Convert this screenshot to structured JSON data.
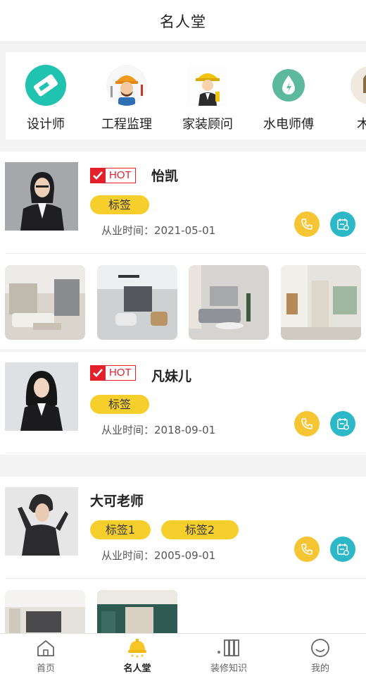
{
  "header": {
    "title": "名人堂"
  },
  "categories": [
    {
      "label": "设计师",
      "icon": "designer-icon"
    },
    {
      "label": "工程监理",
      "icon": "supervisor-icon"
    },
    {
      "label": "家装顾问",
      "icon": "consultant-icon"
    },
    {
      "label": "水电师傅",
      "icon": "plumber-icon"
    },
    {
      "label": "木工",
      "icon": "carpenter-icon"
    }
  ],
  "people": [
    {
      "hot": "HOT",
      "name": "怡凯",
      "tags": [
        "标签"
      ],
      "since_label": "从业时间：",
      "since": "2021-05-01"
    },
    {
      "hot": "HOT",
      "name": "凡妹儿",
      "tags": [
        "标签"
      ],
      "since_label": "从业时间：",
      "since": "2018-09-01"
    },
    {
      "name": "大可老师",
      "tags": [
        "标签1",
        "标签2"
      ],
      "since_label": "从业时间：",
      "since": "2005-09-01"
    }
  ],
  "tabbar": [
    {
      "label": "首页",
      "icon": "home-icon",
      "active": false
    },
    {
      "label": "名人堂",
      "icon": "fame-icon",
      "active": true
    },
    {
      "label": "装修知识",
      "icon": "books-icon",
      "active": false
    },
    {
      "label": "我的",
      "icon": "smile-icon",
      "active": false
    }
  ],
  "colors": {
    "accent": "#f7cf2d",
    "hot": "#e4212b",
    "teal": "#2db8c8",
    "phone": "#f6c534"
  }
}
